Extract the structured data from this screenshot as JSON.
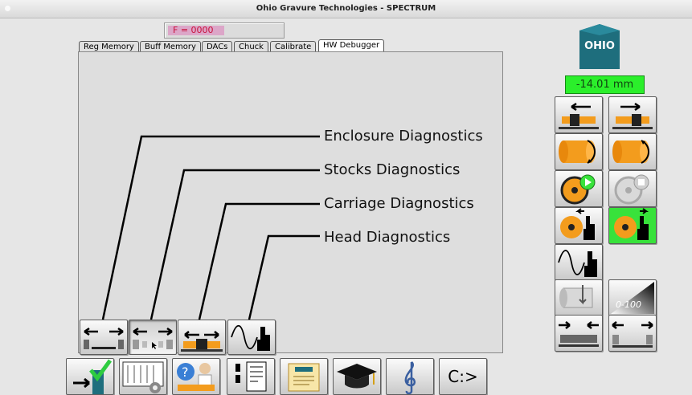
{
  "window": {
    "title": "Ohio Gravure Technologies - SPECTRUM"
  },
  "status": {
    "f_value": "F = 0000",
    "position": "-14.01 mm"
  },
  "logo": {
    "text": "OHIO"
  },
  "tabs": [
    "Reg Memory",
    "Buff Memory",
    "DACs",
    "Chuck",
    "Calibrate",
    "HW Debugger"
  ],
  "active_tab": "HW Debugger",
  "diagnostics": [
    "Enclosure Diagnostics",
    "Stocks Diagnostics",
    "Carriage Diagnostics",
    "Head Diagnostics"
  ],
  "bottom_toolbar": {
    "cmd_label": "C:>"
  },
  "colors": {
    "accent_green": "#38e23b",
    "logo_teal": "#1e6e7d",
    "orange": "#f39c1d",
    "f_text": "#c8113b"
  },
  "icons": {
    "diag_buttons": [
      "enclosure-icon",
      "stocks-icon",
      "carriage-icon",
      "head-wave-icon"
    ],
    "right_panel": [
      "carriage-left-icon",
      "carriage-right-icon",
      "cylinder-rotate-ccw-icon",
      "cylinder-rotate-cw-icon",
      "cylinder-play-icon",
      "cylinder-stop-icon",
      "cylinder-hand-left-icon",
      "cylinder-hand-right-icon",
      "wave-hand-icon",
      "cylinder-depth-icon",
      "gradient-0-100-icon",
      "stocks-in-icon",
      "stocks-out-icon"
    ],
    "bottom": [
      "exit-icon",
      "settings-graph-icon",
      "help-icon",
      "document-icon",
      "diploma-icon",
      "graduation-cap-icon",
      "music-clef-icon",
      "command-prompt-icon"
    ]
  },
  "right_panel_state": {
    "cylinder_hand_right_active": true
  }
}
